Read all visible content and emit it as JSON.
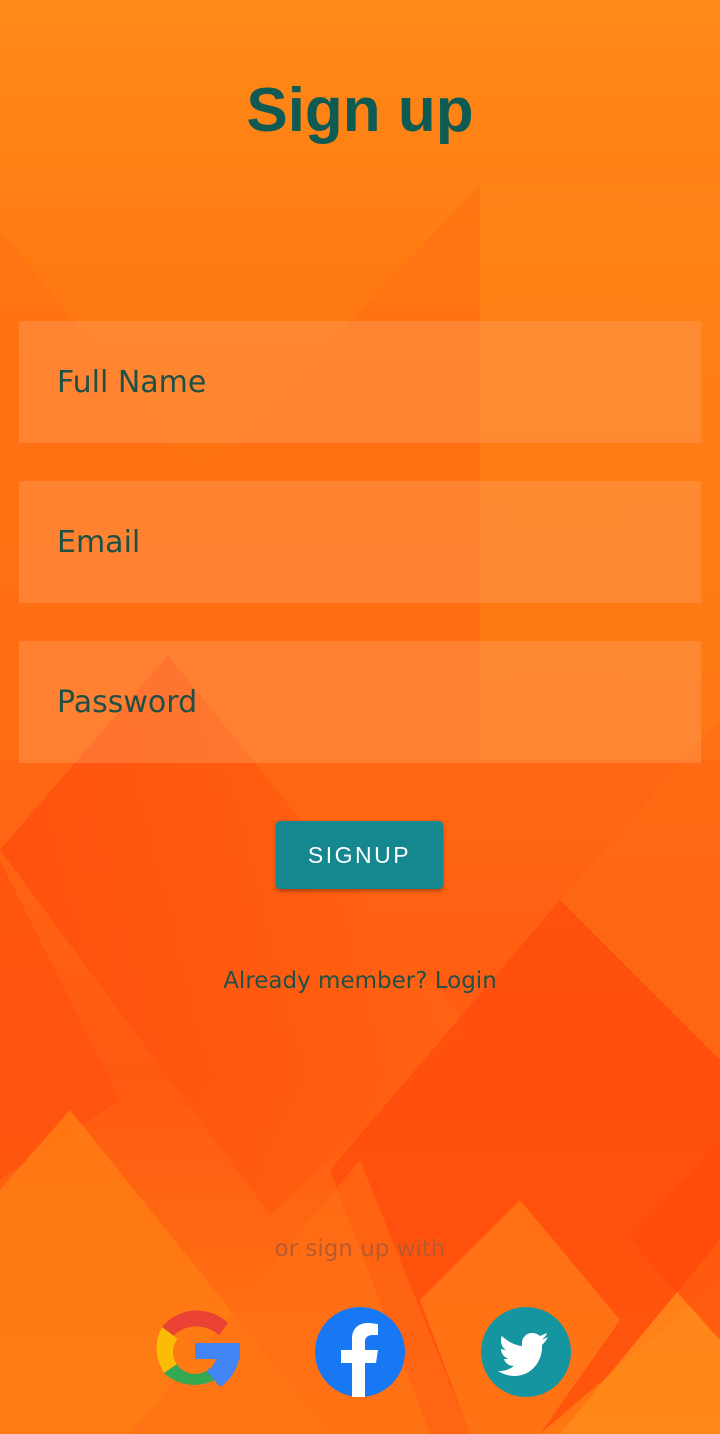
{
  "screen": {
    "title": "Sign up"
  },
  "form": {
    "full_name_placeholder": "Full Name",
    "email_placeholder": "Email",
    "password_placeholder": "Password",
    "submit_label": "SIGNUP"
  },
  "links": {
    "login": "Already member? Login"
  },
  "social": {
    "prompt": "or sign up with",
    "providers": [
      {
        "name": "google",
        "icon": "google-icon"
      },
      {
        "name": "facebook",
        "icon": "facebook-icon"
      },
      {
        "name": "twitter",
        "icon": "twitter-icon"
      }
    ]
  },
  "colors": {
    "accent": "#14878f",
    "title": "#0f5a52",
    "background": "#ff7a12",
    "facebook": "#1877f2",
    "twitter": "#14959f"
  }
}
